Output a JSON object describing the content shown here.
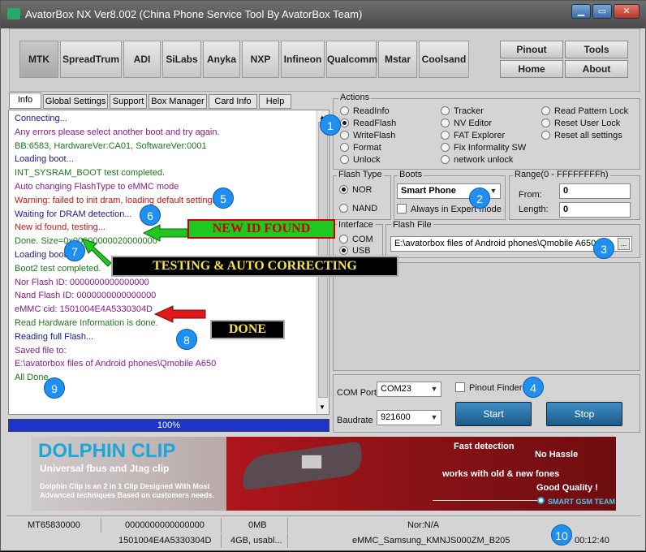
{
  "window": {
    "title": "AvatorBox NX Ver8.002 (China Phone Service Tool By AvatorBox Team)",
    "minimize": "▁",
    "restore": "▭",
    "close": "✕"
  },
  "platform_tabs": [
    "MTK",
    "SpreadTrum",
    "ADI",
    "SiLabs",
    "Anyka",
    "NXP",
    "Infineon",
    "Qualcomm",
    "Mstar",
    "Coolsand"
  ],
  "right_buttons": {
    "pinout": "Pinout",
    "tools": "Tools",
    "home": "Home",
    "about": "About"
  },
  "left_tabs": [
    "Info",
    "Global Settings",
    "Support",
    "Box Manager",
    "Card Info",
    "Help"
  ],
  "log": [
    {
      "text": "Connecting...",
      "color": "#1a1aa0"
    },
    {
      "text": "Any errors please select another boot and try again.",
      "color": "#8a1a8a"
    },
    {
      "text": "BB:6583,    HardwareVer:CA01,    SoftwareVer:0001",
      "color": "#1a7a1a"
    },
    {
      "text": "Loading boot...",
      "color": "#1a1aa0"
    },
    {
      "text": "INT_SYSRAM_BOOT test completed.",
      "color": "#1a7a1a"
    },
    {
      "text": "Auto changing FlashType to eMMC mode",
      "color": "#8a1a8a"
    },
    {
      "text": "Warning: failed to init dram, loading default settings.",
      "color": "#c0181a"
    },
    {
      "text": "Waiting for DRAM detection...",
      "color": "#1a1aa0"
    },
    {
      "text": "New id found, testing...",
      "color": "#c0181a"
    },
    {
      "text": "Done. Size=0x00000000020000000",
      "color": "#1a7a1a"
    },
    {
      "text": "Loading boot...",
      "color": "#1a1aa0"
    },
    {
      "text": "Boot2 test completed.",
      "color": "#1a7a1a"
    },
    {
      "text": "Nor Flash ID: 0000000000000000",
      "color": "#8a1a8a"
    },
    {
      "text": "Nand Flash ID: 0000000000000000",
      "color": "#8a1a8a"
    },
    {
      "text": "eMMC cid: 1501004E4A5330304D",
      "color": "#8a1a8a"
    },
    {
      "text": "Read Hardware Information is done.",
      "color": "#1a7a1a"
    },
    {
      "text": "Reading full Flash...",
      "color": "#1a1aa0"
    },
    {
      "text": "Saved file to:",
      "color": "#8a1a8a"
    },
    {
      "text": "E:\\avatorbox files of Android phones\\Qmobile A650",
      "color": "#8a1a8a"
    },
    {
      "text": "All Done.",
      "color": "#1a7a1a"
    }
  ],
  "progress": {
    "label": "100%",
    "value": 1.0
  },
  "actions": {
    "label": "Actions",
    "col1": [
      "ReadInfo",
      "ReadFlash",
      "WriteFlash",
      "Format",
      "Unlock"
    ],
    "col2": [
      "Tracker",
      "NV Editor",
      "FAT Explorer",
      "Fix Informality SW",
      "network unlock"
    ],
    "col3": [
      "Read Pattern Lock",
      "Reset User Lock",
      "Reset all settings"
    ],
    "selected": "ReadFlash"
  },
  "flash_type": {
    "label": "Flash Type",
    "options": [
      "NOR",
      "NAND"
    ],
    "selected": "NOR"
  },
  "boots": {
    "label": "Boots",
    "value": "Smart Phone",
    "always_expert": "Always in Expert mode"
  },
  "range": {
    "label": "Range(0 - FFFFFFFFh)",
    "from_label": "From:",
    "from_value": "0",
    "length_label": "Length:",
    "length_value": "0"
  },
  "interface": {
    "label": "Interface",
    "options": [
      "COM",
      "USB"
    ],
    "selected": "USB"
  },
  "flash_file": {
    "label": "Flash File",
    "value": "E:\\avatorbox files of Android phones\\Qmobile A650",
    "browse": "..."
  },
  "com_port": {
    "label": "COM Port",
    "value": "COM23"
  },
  "baudrate": {
    "label": "Baudrate",
    "value": "921600"
  },
  "pinout_finder": "Pinout Finder",
  "start": "Start",
  "stop": "Stop",
  "annotations": {
    "new_id": "NEW ID FOUND",
    "testing": "TESTING & AUTO CORRECTING",
    "done": "DONE",
    "badges": [
      "1",
      "2",
      "3",
      "4",
      "5",
      "6",
      "7",
      "8",
      "9",
      "10"
    ]
  },
  "banner": {
    "title": "DOLPHIN CLIP",
    "subtitle": "Universal fbus and Jtag clip",
    "desc1": "Dolphin Clip is an 2 in 1 Clip Designed With Most",
    "desc2": "Advanced techniques Based on customers needs.",
    "f1": "Fast detection",
    "f2": "No Hassle",
    "f3": "works with old & new fones",
    "f4": "Good Quality !",
    "f5": "SMART GSM TEAM"
  },
  "status": {
    "row1": [
      "MT65830000",
      "0000000000000000",
      "0MB",
      "Nor:N/A"
    ],
    "row2": [
      "1501004E4A5330304D",
      "4GB, usabl...",
      "eMMC_Samsung_KMNJS000ZM_B205",
      "00:12:40"
    ]
  },
  "colors": {
    "accent": "#1d34c8",
    "badge": "#1f8ff0",
    "start_stop": "#2a78b0"
  }
}
